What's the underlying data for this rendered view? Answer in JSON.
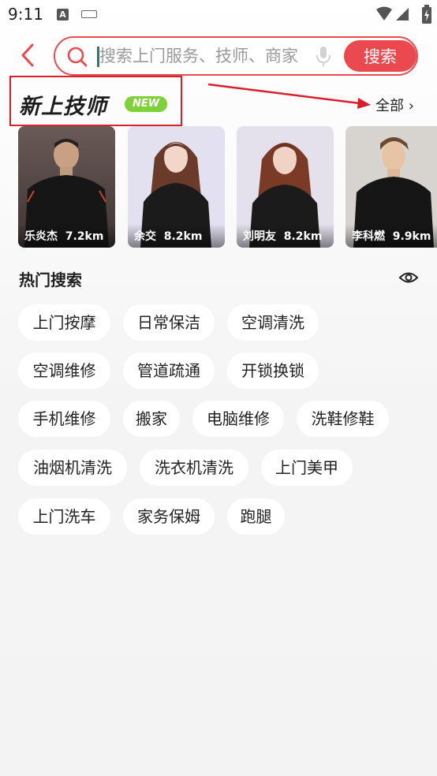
{
  "status_bar": {
    "time": "9:11"
  },
  "header": {
    "search_placeholder": "搜索上门服务、技师、商家",
    "search_button": "搜索"
  },
  "new_techs": {
    "title": "新上技师",
    "badge": "NEW",
    "see_all": "全部 ›",
    "items": [
      {
        "name": "乐炎杰",
        "distance": "7.2km"
      },
      {
        "name": "余交",
        "distance": "8.2km"
      },
      {
        "name": "刘明友",
        "distance": "8.2km"
      },
      {
        "name": "李科燃",
        "distance": "9.9km"
      }
    ]
  },
  "hot_search": {
    "title": "热门搜索",
    "items": [
      "上门按摩",
      "日常保洁",
      "空调清洗",
      "空调维修",
      "管道疏通",
      "开锁换锁",
      "手机维修",
      "搬家",
      "电脑维修",
      "洗鞋修鞋",
      "油烟机清洗",
      "洗衣机清洗",
      "上门美甲",
      "上门洗车",
      "家务保姆",
      "跑腿"
    ]
  },
  "colors": {
    "accent": "#ea4a4f",
    "annotation": "#d9202a",
    "badge": "#7fd13a"
  }
}
